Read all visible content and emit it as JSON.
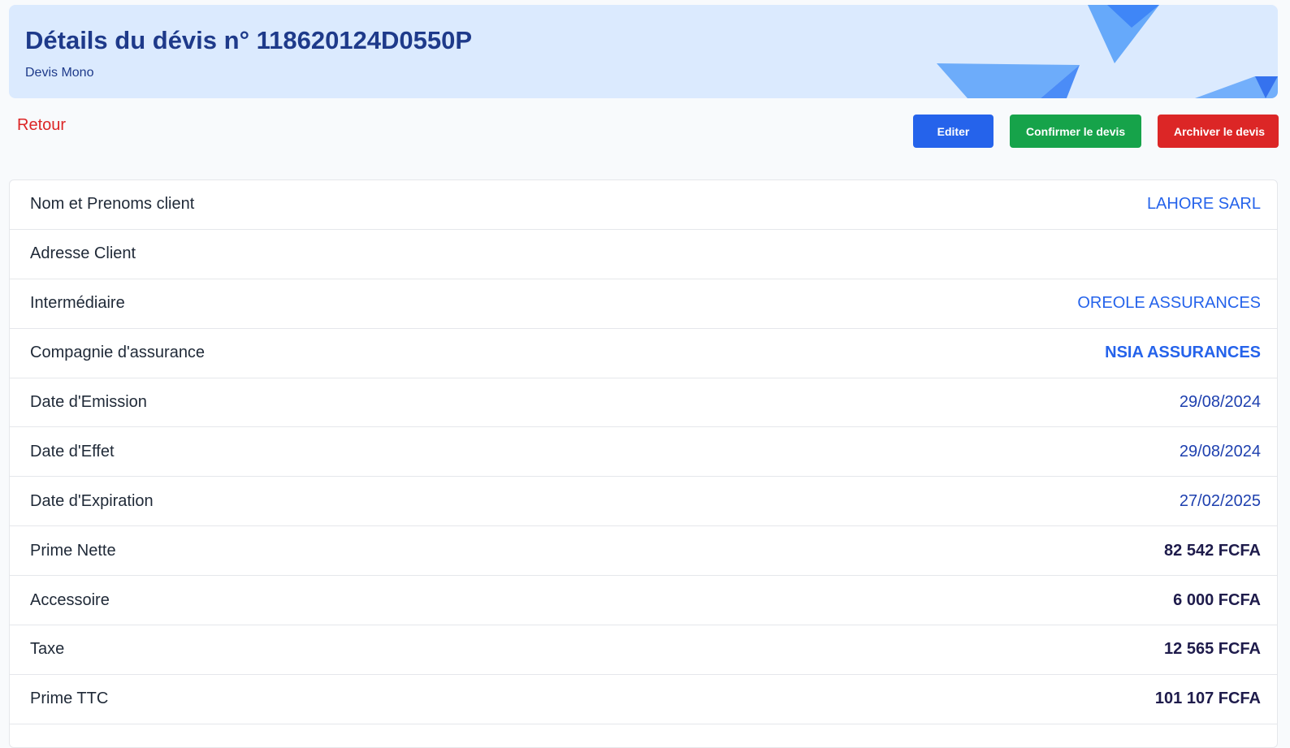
{
  "header": {
    "title": "Détails du dévis n° 118620124D0550P",
    "subtitle": "Devis Mono"
  },
  "nav": {
    "back_label": "Retour"
  },
  "actions": {
    "edit_label": "Editer",
    "confirm_label": "Confirmer le devis",
    "archive_label": "Archiver le devis"
  },
  "colors": {
    "banner_bg": "#dbeafe",
    "title": "#1e3a8a",
    "edit": "#2563eb",
    "confirm": "#16a34a",
    "archive": "#dc2626"
  },
  "details": [
    {
      "label": "Nom et Prenoms client",
      "value": "LAHORE SARL"
    },
    {
      "label": "Adresse Client",
      "value": ""
    },
    {
      "label": "Intermédiaire",
      "value": "OREOLE ASSURANCES"
    },
    {
      "label": "Compagnie d'assurance",
      "value": "NSIA ASSURANCES"
    },
    {
      "label": "Date d'Emission",
      "value": "29/08/2024"
    },
    {
      "label": "Date d'Effet",
      "value": "29/08/2024"
    },
    {
      "label": "Date d'Expiration",
      "value": "27/02/2025"
    },
    {
      "label": "Prime Nette",
      "value": "82 542 FCFA"
    },
    {
      "label": "Accessoire",
      "value": "6 000 FCFA"
    },
    {
      "label": "Taxe",
      "value": "12 565 FCFA"
    },
    {
      "label": "Prime TTC",
      "value": "101 107 FCFA"
    }
  ]
}
